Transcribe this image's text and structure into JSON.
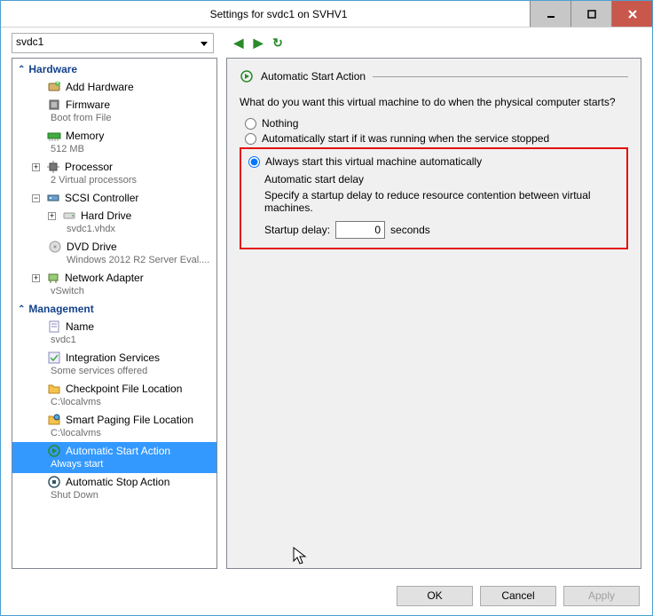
{
  "window": {
    "title": "Settings for svdc1 on SVHV1"
  },
  "toolbar": {
    "vm_selected": "svdc1"
  },
  "sidebar": {
    "hardware": {
      "label": "Hardware",
      "items": [
        {
          "label": "Add Hardware",
          "desc": ""
        },
        {
          "label": "Firmware",
          "desc": "Boot from File"
        },
        {
          "label": "Memory",
          "desc": "512 MB"
        },
        {
          "label": "Processor",
          "desc": "2 Virtual processors",
          "expandable": true
        },
        {
          "label": "SCSI Controller",
          "desc": "",
          "expandable": true
        },
        {
          "label": "Hard Drive",
          "desc": "svdc1.vhdx",
          "sub": true,
          "expandable": true
        },
        {
          "label": "DVD Drive",
          "desc": "Windows 2012 R2 Server Eval....",
          "sub": true
        },
        {
          "label": "Network Adapter",
          "desc": "vSwitch",
          "expandable": true
        }
      ]
    },
    "management": {
      "label": "Management",
      "items": [
        {
          "label": "Name",
          "desc": "svdc1"
        },
        {
          "label": "Integration Services",
          "desc": "Some services offered"
        },
        {
          "label": "Checkpoint File Location",
          "desc": "C:\\localvms"
        },
        {
          "label": "Smart Paging File Location",
          "desc": "C:\\localvms"
        },
        {
          "label": "Automatic Start Action",
          "desc": "Always start",
          "selected": true
        },
        {
          "label": "Automatic Stop Action",
          "desc": "Shut Down"
        }
      ]
    }
  },
  "content": {
    "title": "Automatic Start Action",
    "question": "What do you want this virtual machine to do when the physical computer starts?",
    "opt_nothing": "Nothing",
    "opt_autostart_running": "Automatically start if it was running when the service stopped",
    "opt_always": "Always start this virtual machine automatically",
    "selected": "always",
    "group_title": "Automatic start delay",
    "group_desc": "Specify a startup delay to reduce resource contention between virtual machines.",
    "delay_label": "Startup delay:",
    "delay_value": "0",
    "delay_unit": "seconds"
  },
  "footer": {
    "ok": "OK",
    "cancel": "Cancel",
    "apply": "Apply"
  }
}
